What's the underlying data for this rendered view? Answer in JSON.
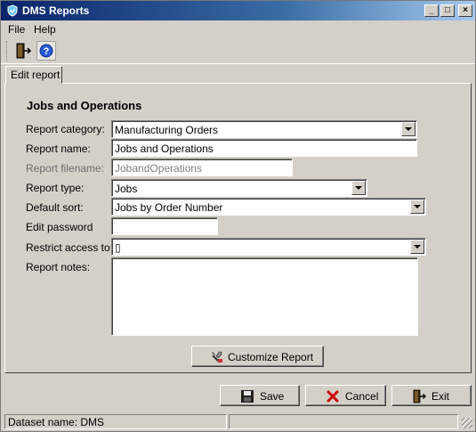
{
  "window": {
    "title": "DMS Reports"
  },
  "menu": {
    "file": "File",
    "help": "Help"
  },
  "tab": {
    "label": "Edit report"
  },
  "form": {
    "section_title": "Jobs and Operations",
    "report_category_label": "Report category:",
    "report_category_value": "Manufacturing Orders",
    "report_name_label": "Report name:",
    "report_name_value": "Jobs and Operations",
    "report_filename_label": "Report filename:",
    "report_filename_value": "JobandOperations",
    "report_type_label": "Report type:",
    "report_type_value": "Jobs",
    "default_sort_label": "Default sort:",
    "default_sort_value": "Jobs by Order Number",
    "edit_password_label": "Edit password",
    "edit_password_value": "",
    "restrict_access_label": "Restrict access to:",
    "restrict_access_value": "▯",
    "report_notes_label": "Report notes:",
    "report_notes_value": ""
  },
  "buttons": {
    "customize": "Customize Report",
    "save": "Save",
    "cancel": "Cancel",
    "exit": "Exit"
  },
  "status": {
    "dataset": "Dataset name:  DMS",
    "panel2": ""
  },
  "colors": {
    "titlebar_start": "#0a246a",
    "titlebar_end": "#a6caf0",
    "face": "#d4d0c8",
    "cancel_icon": "#cc0000"
  },
  "icons": {
    "title": "shield-icon",
    "toolbar_exit": "exit-door-icon",
    "toolbar_help": "help-icon",
    "customize": "tools-icon",
    "save": "floppy-disk-icon",
    "cancel": "red-x-icon",
    "exit": "exit-door-icon"
  }
}
